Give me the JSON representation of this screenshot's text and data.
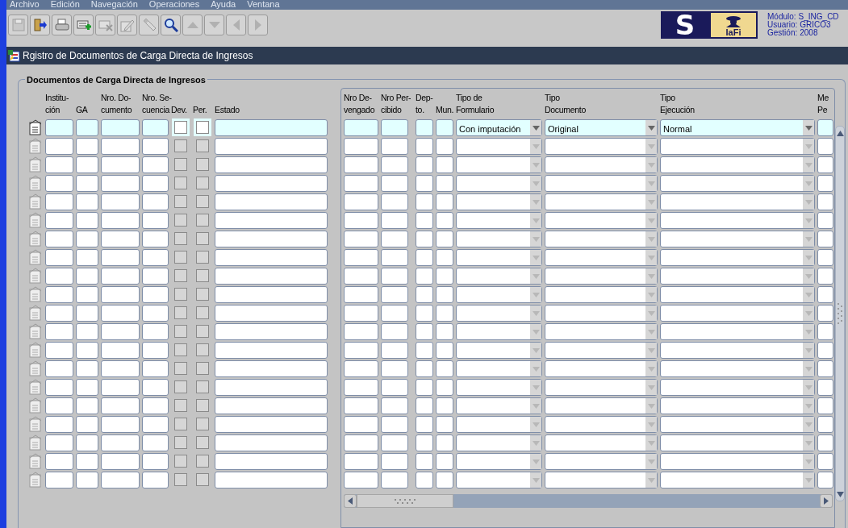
{
  "menu": [
    "Archivo",
    "Edición",
    "Navegación",
    "Operaciones",
    "Ayuda",
    "Ventana"
  ],
  "toolbar": [
    {
      "kind": "save",
      "disabled": true
    },
    {
      "kind": "exit",
      "disabled": false
    },
    {
      "kind": "print",
      "disabled": false
    },
    {
      "kind": "insert",
      "disabled": false
    },
    {
      "kind": "delete",
      "disabled": true
    },
    {
      "kind": "edit",
      "disabled": true
    },
    {
      "kind": "clear",
      "disabled": true
    },
    {
      "kind": "search",
      "disabled": false
    },
    {
      "kind": "up",
      "disabled": true
    },
    {
      "kind": "down",
      "disabled": true
    },
    {
      "kind": "prev",
      "disabled": true
    },
    {
      "kind": "next",
      "disabled": true
    }
  ],
  "logo": {
    "letter": "S",
    "text": "IaFi"
  },
  "session": [
    {
      "label": "Módulo:",
      "value": "S_ING_CD"
    },
    {
      "label": "Usuario:",
      "value": "GRICO3"
    },
    {
      "label": "Gestión:",
      "value": "2008"
    }
  ],
  "window": {
    "title": "Rgistro de Documentos de Carga Directa de Ingresos"
  },
  "frame": {
    "title": "Documentos de Carga Directa de Ingresos"
  },
  "left_columns": [
    "Institu-\nción",
    "\nGA",
    "Nro. Do-\ncumento",
    "Nro. Se-\ncuencia",
    "\nDev.",
    "\nPer.",
    "\nEstado"
  ],
  "right_columns": [
    "Nro De-\nvengado",
    "Nro Per-\ncibido",
    "Dep-\nto.",
    "\nMun.",
    "Tipo de\nFormulario",
    "Tipo\nDocumento",
    "Tipo\nEjecución",
    "Me\nPe"
  ],
  "rows": [
    {
      "selected": true,
      "dev": false,
      "per": false,
      "tipo_formulario": "Con imputación",
      "tipo_documento": "Original",
      "tipo_ejecucion": "Normal"
    },
    {
      "selected": false,
      "dev": false,
      "per": false
    },
    {
      "selected": false,
      "dev": false,
      "per": false
    },
    {
      "selected": false,
      "dev": false,
      "per": false
    },
    {
      "selected": false,
      "dev": false,
      "per": false
    },
    {
      "selected": false,
      "dev": false,
      "per": false
    },
    {
      "selected": false,
      "dev": false,
      "per": false
    },
    {
      "selected": false,
      "dev": false,
      "per": false
    },
    {
      "selected": false,
      "dev": false,
      "per": false
    },
    {
      "selected": false,
      "dev": false,
      "per": false
    },
    {
      "selected": false,
      "dev": false,
      "per": false
    },
    {
      "selected": false,
      "dev": false,
      "per": false
    },
    {
      "selected": false,
      "dev": false,
      "per": false
    },
    {
      "selected": false,
      "dev": false,
      "per": false
    },
    {
      "selected": false,
      "dev": false,
      "per": false
    },
    {
      "selected": false,
      "dev": false,
      "per": false
    },
    {
      "selected": false,
      "dev": false,
      "per": false
    },
    {
      "selected": false,
      "dev": false,
      "per": false
    },
    {
      "selected": false,
      "dev": false,
      "per": false
    },
    {
      "selected": false,
      "dev": false,
      "per": false
    }
  ]
}
